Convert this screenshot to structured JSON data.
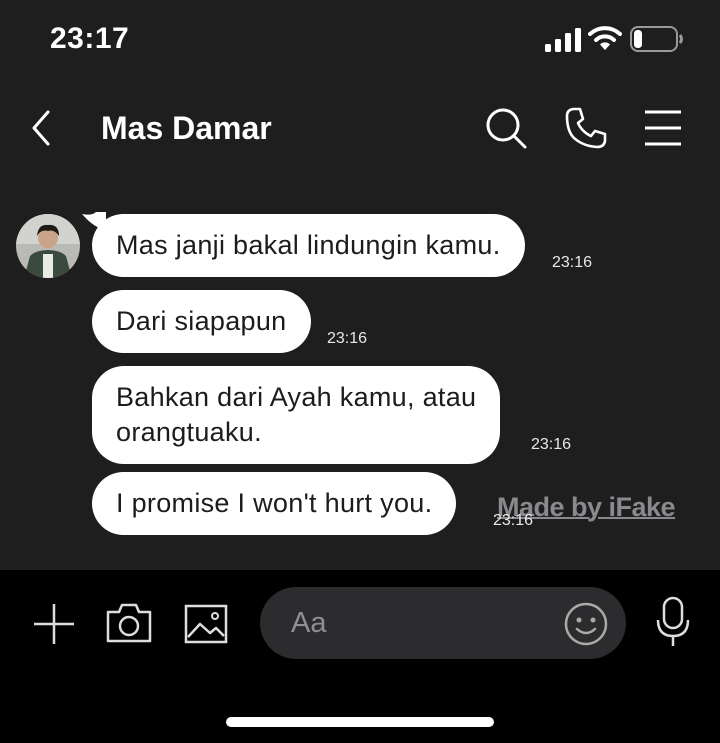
{
  "status_bar": {
    "time": "23:17"
  },
  "header": {
    "contact_name": "Mas Damar"
  },
  "messages": [
    {
      "text": "Mas janji bakal lindungin kamu.",
      "time": "23:16"
    },
    {
      "text": "Dari siapapun",
      "time": "23:16"
    },
    {
      "text": "Bahkan dari Ayah kamu, atau orangtuaku.",
      "line1": "Bahkan dari Ayah kamu, atau",
      "line2": "orangtuaku.",
      "time": "23:16"
    },
    {
      "text": "I promise I won't hurt you.",
      "time": "23:16"
    }
  ],
  "watermark": "Made by iFake",
  "composer": {
    "placeholder": "Aa"
  },
  "colors": {
    "background": "#1e1e1f",
    "bubble": "#ffffff",
    "input_bar": "#000000",
    "field": "#2c2c2e"
  }
}
